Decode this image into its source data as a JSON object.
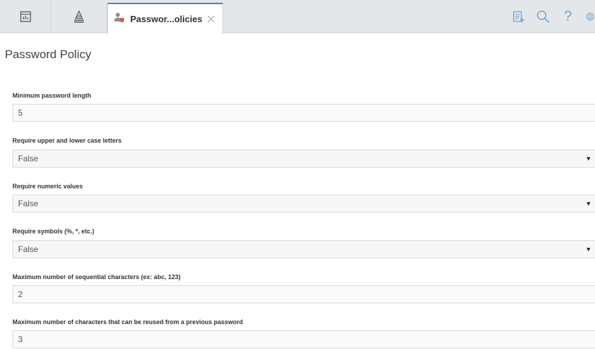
{
  "tabs": {
    "active_tab_title": "Passwor...olicies"
  },
  "toolbar": {
    "help_glyph": "?"
  },
  "page": {
    "title": "Password Policy"
  },
  "fields": [
    {
      "label": "Minimum password length",
      "value": "5",
      "type": "text"
    },
    {
      "label": "Require upper and lower case letters",
      "value": "False",
      "type": "select"
    },
    {
      "label": "Require numeric values",
      "value": "False",
      "type": "select"
    },
    {
      "label": "Require symbols (%, *, etc.)",
      "value": "False",
      "type": "select"
    },
    {
      "label": "Maximum number of sequential characters (ex: abc, 123)",
      "value": "2",
      "type": "text"
    },
    {
      "label": "Maximum number of characters that can be reused from a previous password",
      "value": "3",
      "type": "text"
    }
  ],
  "colors": {
    "accent": "#3e87c8",
    "tabbar_bg": "#e4e7ea",
    "icon_blue": "#6fa3d6"
  },
  "icons": {
    "tab_dashboard": "dashboard-icon",
    "tab_hierarchy": "hierarchy-icon",
    "tab_active": "user-shield-icon",
    "close": "close-icon",
    "toolbar_notes": "clipboard-add-icon",
    "toolbar_search": "search-icon",
    "toolbar_help": "help-icon",
    "toolbar_settings": "gear-icon"
  }
}
